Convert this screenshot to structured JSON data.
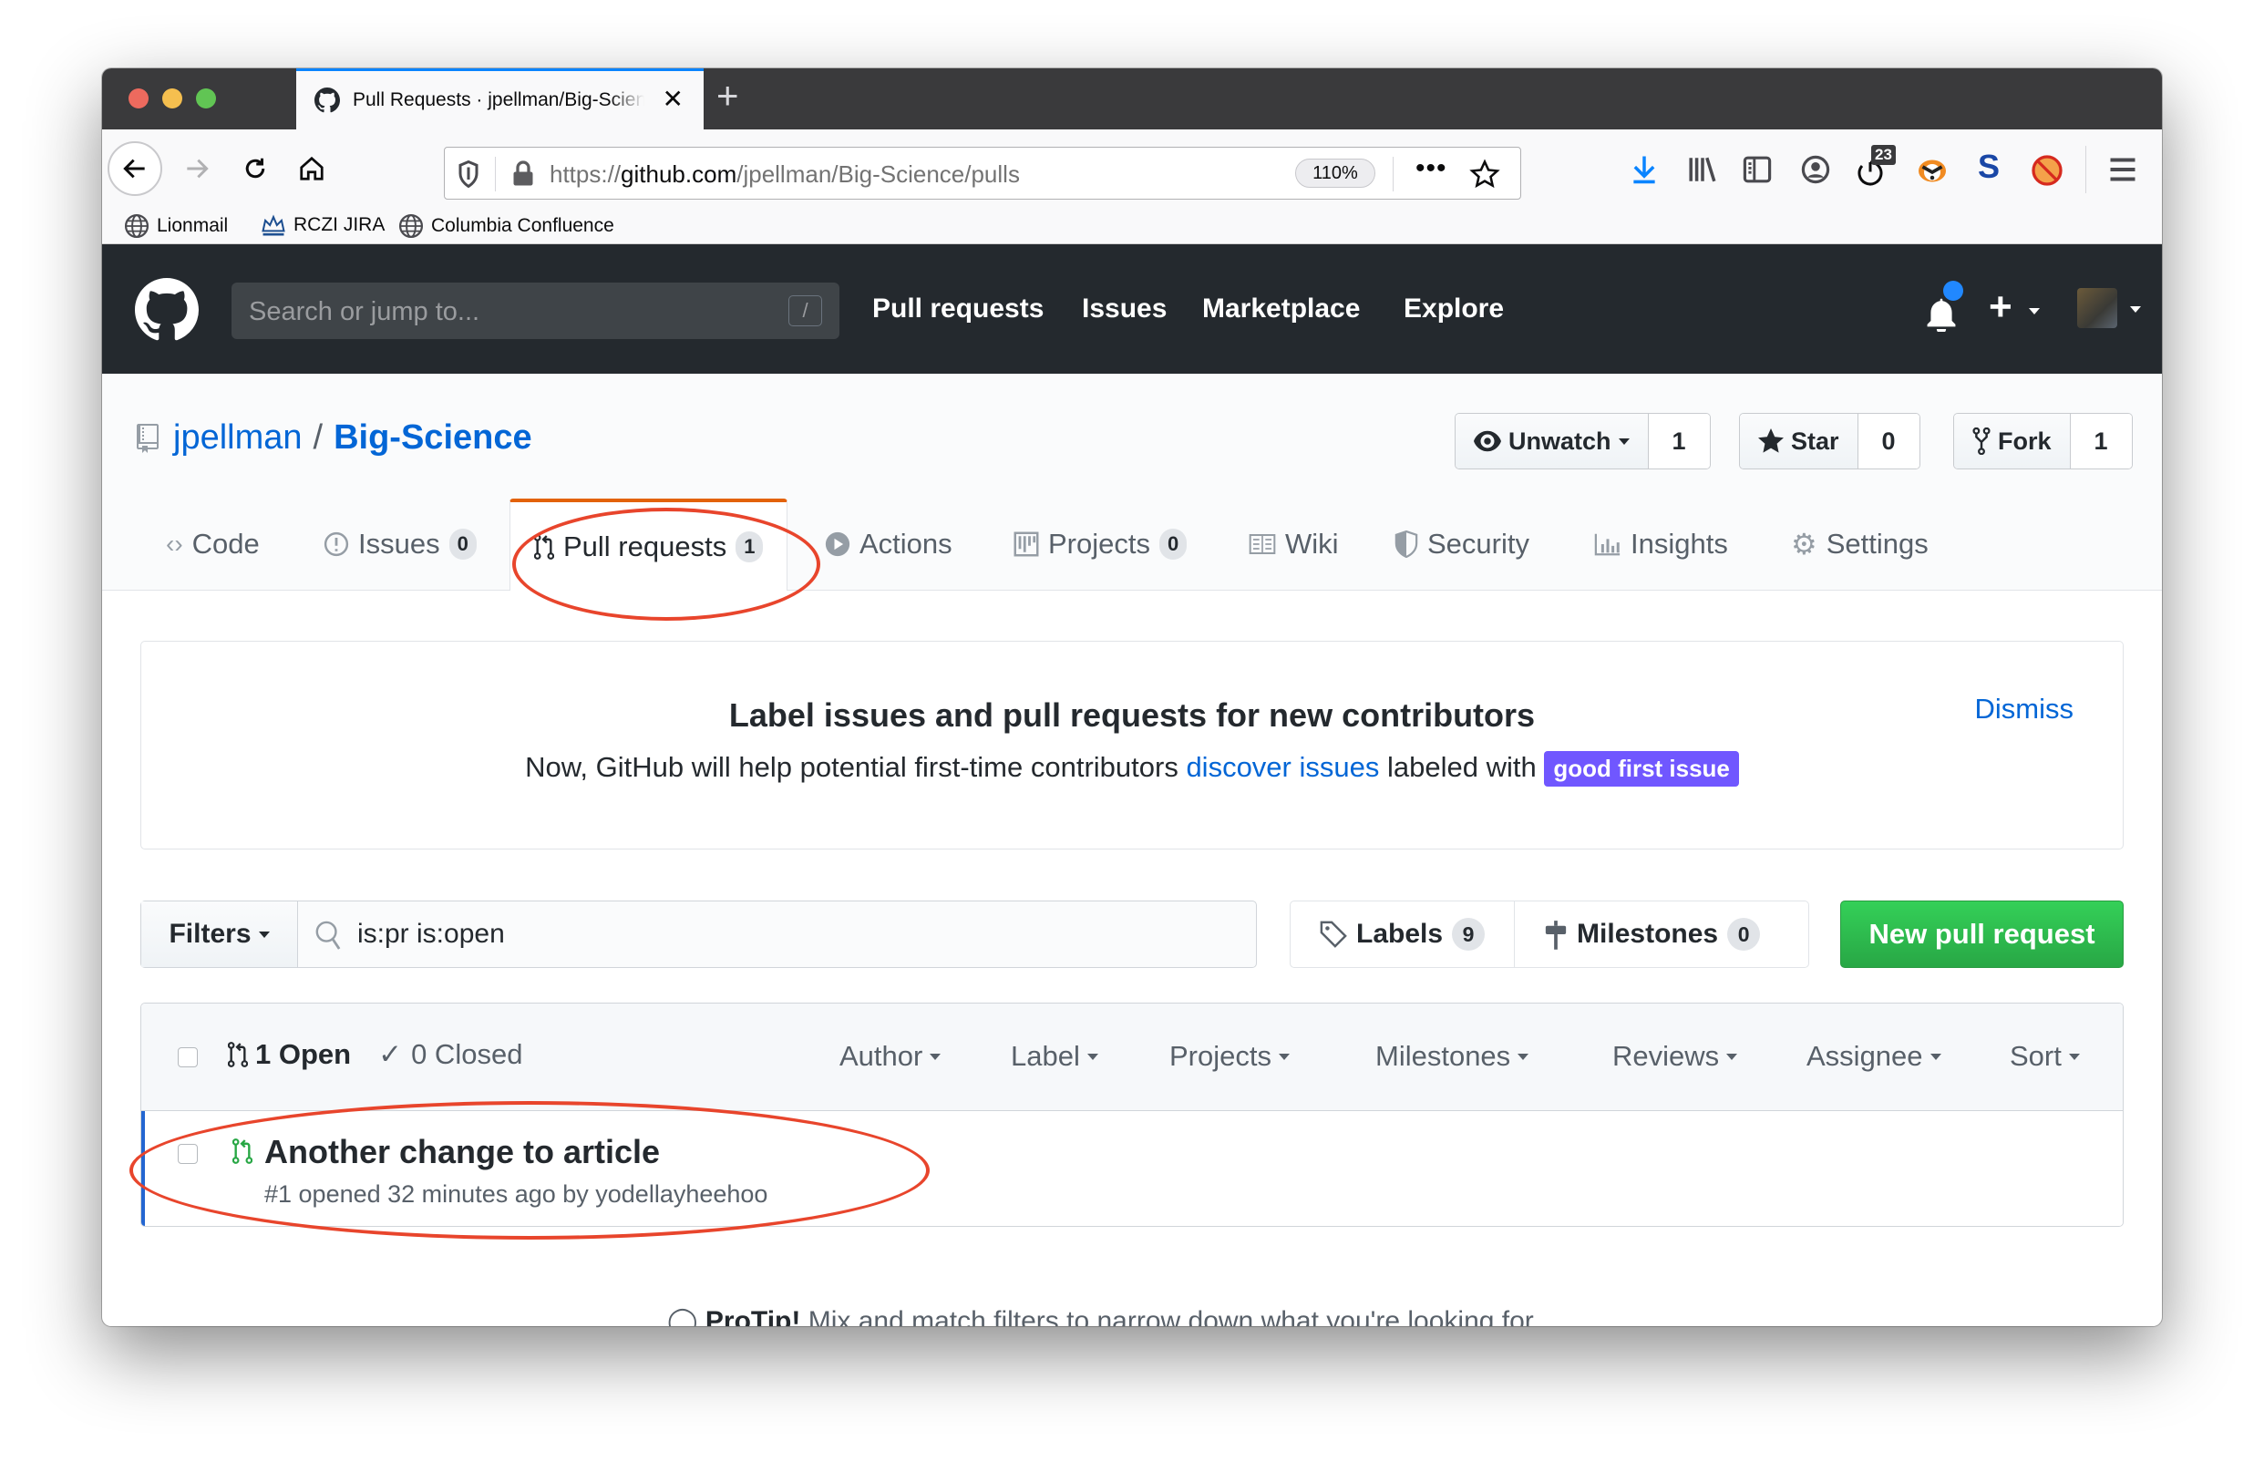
{
  "browser": {
    "tab": {
      "title": "Pull Requests · jpellman/Big-Science",
      "close_icon": "close-icon"
    },
    "new_tab_label": "+",
    "url": {
      "scheme": "https://",
      "host": "github.com",
      "path": "/jpellman/Big-Science/pulls"
    },
    "zoom_level": "110%",
    "toolbar_badge_count": "23",
    "bookmarks": [
      {
        "label": "Lionmail",
        "icon": "globe-icon"
      },
      {
        "label": "RCZI JIRA",
        "icon": "crown-icon"
      },
      {
        "label": "Columbia Confluence",
        "icon": "globe-icon"
      }
    ]
  },
  "github_header": {
    "search_placeholder": "Search or jump to...",
    "search_shortcut": "/",
    "nav": [
      "Pull requests",
      "Issues",
      "Marketplace",
      "Explore"
    ],
    "notification_unread": true
  },
  "repo": {
    "owner": "jpellman",
    "separator": "/",
    "name": "Big-Science",
    "actions": [
      {
        "label": "Unwatch",
        "count": "1",
        "icon": "eye-icon",
        "has_caret": true
      },
      {
        "label": "Star",
        "count": "0",
        "icon": "star-icon"
      },
      {
        "label": "Fork",
        "count": "1",
        "icon": "fork-icon"
      }
    ],
    "tabs": [
      {
        "label": "Code",
        "icon": "code-icon"
      },
      {
        "label": "Issues",
        "count": "0",
        "icon": "issue-icon"
      },
      {
        "label": "Pull requests",
        "count": "1",
        "icon": "pull-request-icon",
        "selected": true
      },
      {
        "label": "Actions",
        "icon": "play-icon"
      },
      {
        "label": "Projects",
        "count": "0",
        "icon": "project-icon"
      },
      {
        "label": "Wiki",
        "icon": "book-icon"
      },
      {
        "label": "Security",
        "icon": "shield-icon"
      },
      {
        "label": "Insights",
        "icon": "graph-icon"
      },
      {
        "label": "Settings",
        "icon": "gear-icon"
      }
    ]
  },
  "banner": {
    "title": "Label issues and pull requests for new contributors",
    "text_before": "Now, GitHub will help potential first-time contributors ",
    "link": "discover issues",
    "text_after": " labeled with ",
    "label": "good first issue",
    "label_color": "#7057ff",
    "dismiss": "Dismiss"
  },
  "filters": {
    "button": "Filters",
    "query": "is:pr is:open",
    "labels": {
      "label": "Labels",
      "count": "9"
    },
    "milestones": {
      "label": "Milestones",
      "count": "0"
    },
    "new_button": "New pull request"
  },
  "list": {
    "open_label": "1 Open",
    "closed_label": "0 Closed",
    "header_filters": [
      "Author",
      "Label",
      "Projects",
      "Milestones",
      "Reviews",
      "Assignee",
      "Sort"
    ],
    "items": [
      {
        "title": "Another change to article",
        "meta": "#1 opened 32 minutes ago by yodellayheehoo",
        "state": "open"
      }
    ]
  },
  "protip": {
    "bold": "ProTip!",
    "text": " Mix and match filters to narrow down what you're looking for."
  },
  "colors": {
    "accent_link": "#0366d6",
    "green_button": "#28a745",
    "selected_tab_border": "#e36209",
    "annotation": "#e8452c"
  }
}
